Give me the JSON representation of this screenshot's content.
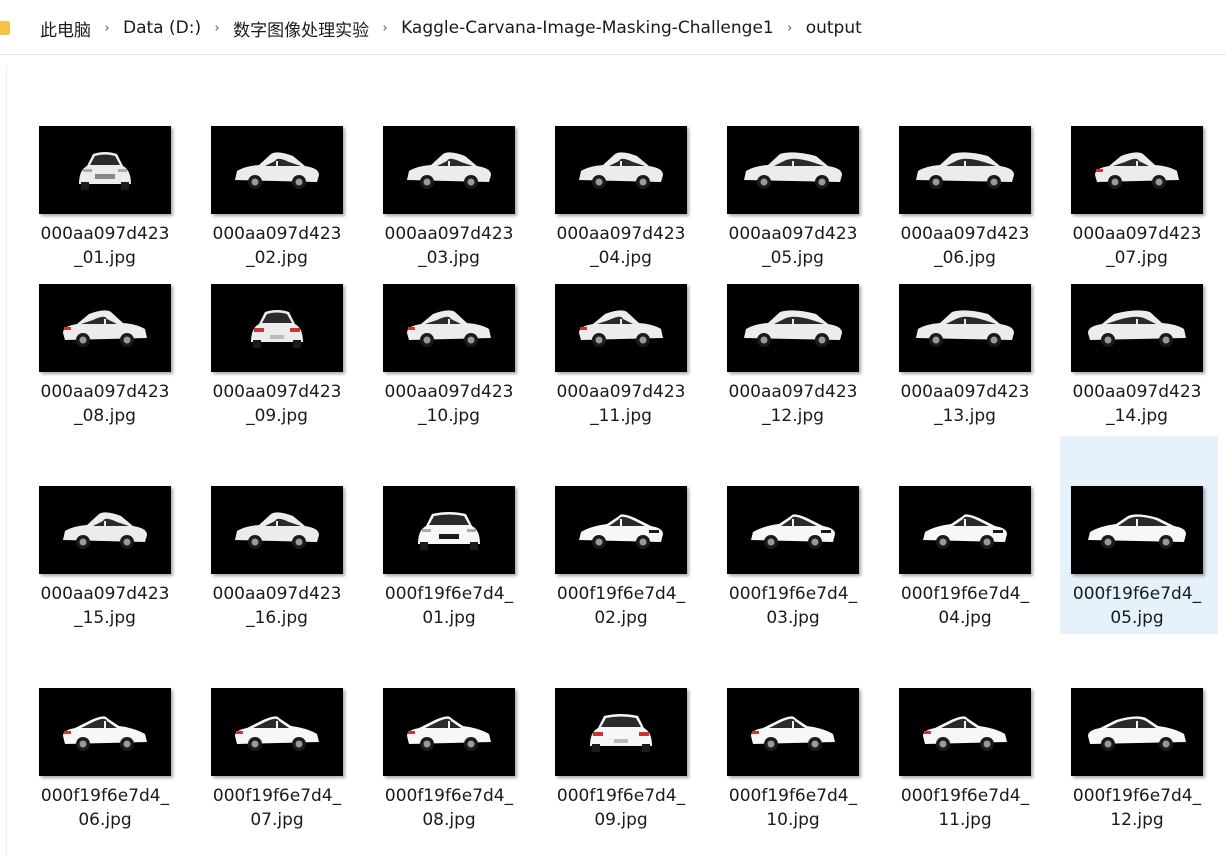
{
  "breadcrumb": [
    {
      "label": "此电脑"
    },
    {
      "label": "Data (D:)"
    },
    {
      "label": "数字图像处理实验"
    },
    {
      "label": "Kaggle-Carvana-Image-Masking-Challenge1"
    },
    {
      "label": "output"
    }
  ],
  "files": [
    {
      "line1": "000aa097d423",
      "line2": "_01.jpg",
      "car": "sedan",
      "view": 1
    },
    {
      "line1": "000aa097d423",
      "line2": "_02.jpg",
      "car": "sedan",
      "view": 2
    },
    {
      "line1": "000aa097d423",
      "line2": "_03.jpg",
      "car": "sedan",
      "view": 3
    },
    {
      "line1": "000aa097d423",
      "line2": "_04.jpg",
      "car": "sedan",
      "view": 4
    },
    {
      "line1": "000aa097d423",
      "line2": "_05.jpg",
      "car": "sedan",
      "view": 5
    },
    {
      "line1": "000aa097d423",
      "line2": "_06.jpg",
      "car": "sedan",
      "view": 6
    },
    {
      "line1": "000aa097d423",
      "line2": "_07.jpg",
      "car": "sedan",
      "view": 7
    },
    {
      "line1": "000aa097d423",
      "line2": "_08.jpg",
      "car": "sedan",
      "view": 8
    },
    {
      "line1": "000aa097d423",
      "line2": "_09.jpg",
      "car": "sedan",
      "view": 9
    },
    {
      "line1": "000aa097d423",
      "line2": "_10.jpg",
      "car": "sedan",
      "view": 10
    },
    {
      "line1": "000aa097d423",
      "line2": "_11.jpg",
      "car": "sedan",
      "view": 11
    },
    {
      "line1": "000aa097d423",
      "line2": "_12.jpg",
      "car": "sedan",
      "view": 12
    },
    {
      "line1": "000aa097d423",
      "line2": "_13.jpg",
      "car": "sedan",
      "view": 13
    },
    {
      "line1": "000aa097d423",
      "line2": "_14.jpg",
      "car": "sedan",
      "view": 14
    },
    {
      "line1": "000aa097d423",
      "line2": "_15.jpg",
      "car": "sedan",
      "view": 15
    },
    {
      "line1": "000aa097d423",
      "line2": "_16.jpg",
      "car": "sedan",
      "view": 16
    },
    {
      "line1": "000f19f6e7d4_",
      "line2": "01.jpg",
      "car": "sports",
      "view": 1
    },
    {
      "line1": "000f19f6e7d4_",
      "line2": "02.jpg",
      "car": "sports",
      "view": 2
    },
    {
      "line1": "000f19f6e7d4_",
      "line2": "03.jpg",
      "car": "sports",
      "view": 3
    },
    {
      "line1": "000f19f6e7d4_",
      "line2": "04.jpg",
      "car": "sports",
      "view": 4
    },
    {
      "line1": "000f19f6e7d4_",
      "line2": "05.jpg",
      "car": "sports",
      "view": 5,
      "selected": true
    },
    {
      "line1": "000f19f6e7d4_",
      "line2": "06.jpg",
      "car": "sports",
      "view": 6
    },
    {
      "line1": "000f19f6e7d4_",
      "line2": "07.jpg",
      "car": "sports",
      "view": 7
    },
    {
      "line1": "000f19f6e7d4_",
      "line2": "08.jpg",
      "car": "sports",
      "view": 8
    },
    {
      "line1": "000f19f6e7d4_",
      "line2": "09.jpg",
      "car": "sports",
      "view": 9
    },
    {
      "line1": "000f19f6e7d4_",
      "line2": "10.jpg",
      "car": "sports",
      "view": 10
    },
    {
      "line1": "000f19f6e7d4_",
      "line2": "11.jpg",
      "car": "sports",
      "view": 11
    },
    {
      "line1": "000f19f6e7d4_",
      "line2": "12.jpg",
      "car": "sports",
      "view": 12
    }
  ],
  "colors": {
    "thumb_bg": "#000000",
    "car_body": "#f2f2f2",
    "selection": "#e5f1fb",
    "folder": "#f5c542"
  }
}
